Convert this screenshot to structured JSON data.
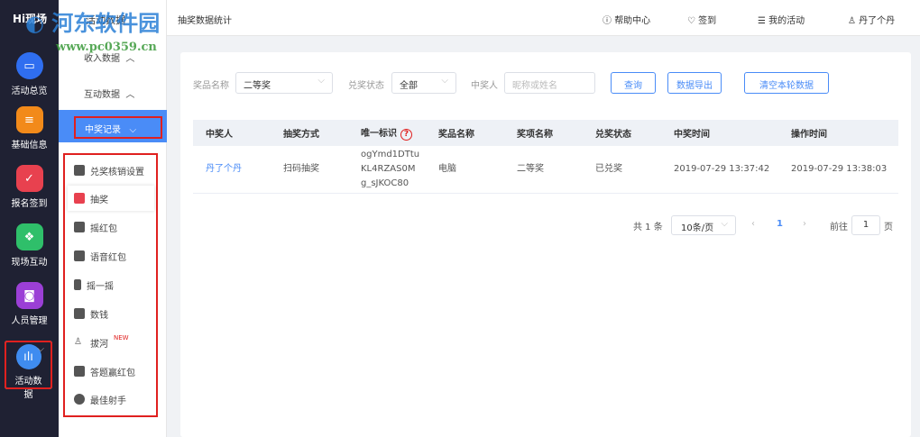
{
  "watermark": {
    "title": "河东软件园",
    "url": "www.pc0359.cn"
  },
  "brand": "Hi现场",
  "nav": [
    {
      "label": "活动总览",
      "color": "#2f6ef0",
      "glyph": "▭"
    },
    {
      "label": "基础信息",
      "color": "#f28a1a",
      "glyph": "≡"
    },
    {
      "label": "报名签到",
      "color": "#e8414f",
      "glyph": "✓"
    },
    {
      "label": "现场互动",
      "color": "#2fbf6a",
      "glyph": "❖"
    },
    {
      "label": "人员管理",
      "color": "#9b3fd6",
      "glyph": "◙"
    },
    {
      "label": "活动数据",
      "color": "#3f8cf0",
      "glyph": "ılı"
    }
  ],
  "sub": {
    "title": "活动数据",
    "groups": [
      "收入数据",
      "互动数据"
    ],
    "active": "中奖记录",
    "items": [
      "兑奖核销设置",
      "抽奖",
      "摇红包",
      "语音红包",
      "摇一摇",
      "数钱",
      "拔河",
      "答题赢红包",
      "最佳射手"
    ],
    "new_badge": "NEW"
  },
  "header": {
    "title": "抽奖数据统计",
    "help": "帮助中心",
    "signin": "签到",
    "my": "我的活动",
    "user": "丹了个丹"
  },
  "filters": {
    "prize_label": "奖品名称",
    "prize_value": "二等奖",
    "status_label": "兑奖状态",
    "status_value": "全部",
    "winner_label": "中奖人",
    "winner_placeholder": "昵称或姓名",
    "query": "查询",
    "export": "数据导出",
    "clear": "清空本轮数据"
  },
  "table": {
    "headers": [
      "中奖人",
      "抽奖方式",
      "唯一标识",
      "奖品名称",
      "奖项名称",
      "兑奖状态",
      "中奖时间",
      "操作时间"
    ],
    "rows": [
      {
        "winner": "丹了个丹",
        "method": "扫码抽奖",
        "id1": "ogYmd1DTtu",
        "id2": "KL4RZAS0M",
        "id3": "g_sJKOC80",
        "prize": "电脑",
        "award": "二等奖",
        "status": "已兑奖",
        "win_time": "2019-07-29 13:37:42",
        "op_time": "2019-07-29 13:38:03"
      }
    ]
  },
  "pagination": {
    "total": "共 1 条",
    "size": "10条/页",
    "page": "1",
    "goto": "前往",
    "goto_value": "1",
    "unit": "页"
  }
}
